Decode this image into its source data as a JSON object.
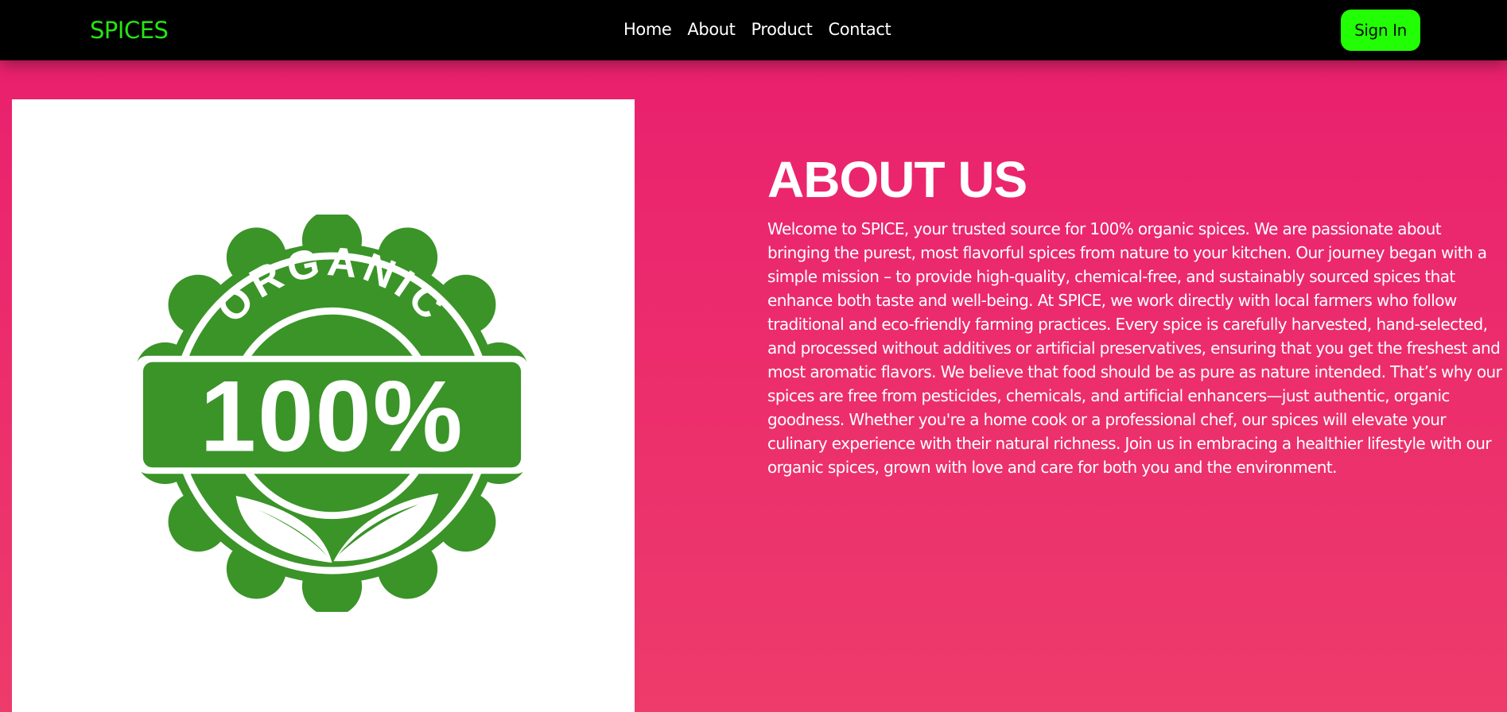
{
  "navbar": {
    "brand": "SPICES",
    "links": [
      {
        "label": "Home"
      },
      {
        "label": "About"
      },
      {
        "label": "Product"
      },
      {
        "label": "Contact"
      }
    ],
    "signin_label": "Sign In"
  },
  "colors": {
    "navbar_bg": "#000000",
    "brand": "#27e414",
    "signin_bg": "#22ff05",
    "page_gradient_top": "#ea1e6e",
    "page_gradient_bottom": "#ed3b6b",
    "badge_green": "#3a9428"
  },
  "badge": {
    "icon": "organic-100-percent-badge",
    "top_text": "ORGANIC",
    "banner_text": "100%"
  },
  "about": {
    "title": "ABOUT US",
    "text": "Welcome to SPICE, your trusted source for 100% organic spices. We are passionate about bringing the purest, most flavorful spices from nature to your kitchen. Our journey began with a simple mission – to provide high-quality, chemical-free, and sustainably sourced spices that enhance both taste and well-being. At SPICE, we work directly with local farmers who follow traditional and eco-friendly farming practices. Every spice is carefully harvested, hand-selected, and processed without additives or artificial preservatives, ensuring that you get the freshest and most aromatic flavors. We believe that food should be as pure as nature intended. That’s why our spices are free from pesticides, chemicals, and artificial enhancers—just authentic, organic goodness. Whether you're a home cook or a professional chef, our spices will elevate your culinary experience with their natural richness. Join us in embracing a healthier lifestyle with our organic spices, grown with love and care for both you and the environment."
  }
}
